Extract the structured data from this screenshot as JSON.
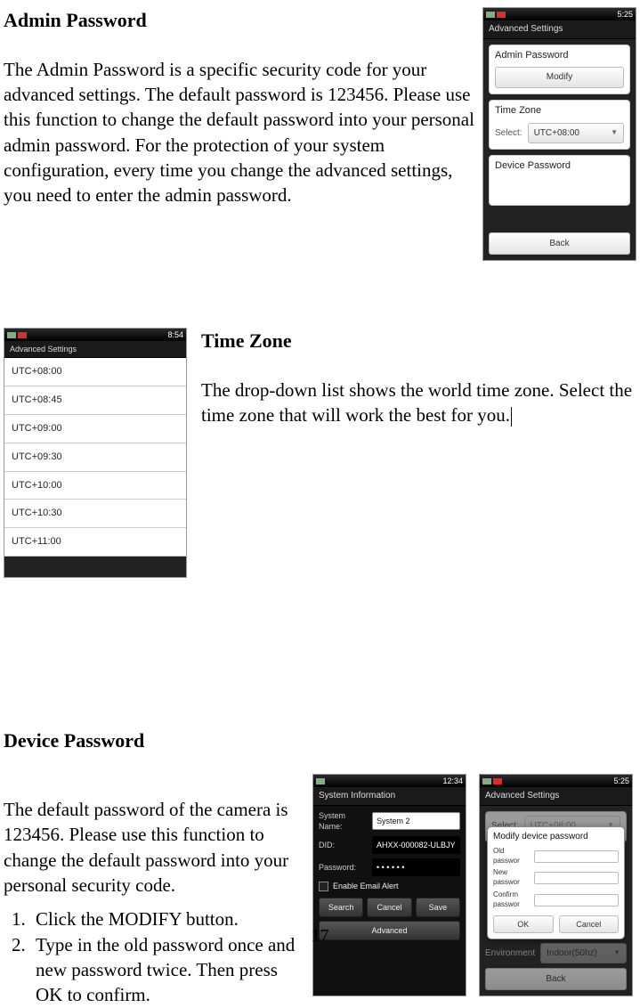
{
  "sections": {
    "admin": {
      "heading": "Admin Password",
      "paragraph": "The Admin Password is a specific security code for your advanced settings. The default password is 123456. Please use this function to change the default password into your personal admin password. For the protection of your system configuration, every time you change the advanced settings, you need to enter the admin password."
    },
    "timezone": {
      "heading": "Time Zone",
      "paragraph": "The drop-down list shows the world time zone. Select the time zone that will work the best for you."
    },
    "device": {
      "heading": "Device Password",
      "intro": "The default password of the camera is 123456. Please use this function to change the default password into your personal security code.",
      "steps": [
        "Click the MODIFY button.",
        "Type in the old password once and new password twice. Then press OK to confirm."
      ]
    }
  },
  "phone": {
    "time1": "5:25",
    "time2": "8:54",
    "time3": "12:34",
    "advanced_title": "Advanced Settings",
    "card_admin": "Admin Password",
    "btn_modify": "Modify",
    "card_tz": "Time Zone",
    "label_select": "Select:",
    "tz_value": "UTC+08:00",
    "card_device": "Device Password",
    "btn_back": "Back",
    "tz_list": [
      "UTC+08:00",
      "UTC+08:45",
      "UTC+09:00",
      "UTC+09:30",
      "UTC+10:00",
      "UTC+10:30",
      "UTC+11:00"
    ],
    "sysinfo_title": "System Information",
    "sys_name_label": "System Name:",
    "sys_name_value": "System 2",
    "sys_did_label": "DID:",
    "sys_did_value": "AHXX-000082-ULBJY",
    "sys_pw_label": "Password:",
    "sys_pw_value": "• • • • • •",
    "email_alert": "Enable Email Alert",
    "btn_search": "Search",
    "btn_cancel": "Cancel",
    "btn_save": "Save",
    "btn_advanced": "Advanced",
    "modal_title": "Modify device password",
    "modal_old": "Old passwor",
    "modal_new": "New passwor",
    "modal_confirm": "Confirm passwor",
    "btn_ok": "OK",
    "btn_cancel2": "Cancel",
    "env_label": "Environment",
    "env_value": "Indoor(50hz)"
  },
  "page_number": "17"
}
